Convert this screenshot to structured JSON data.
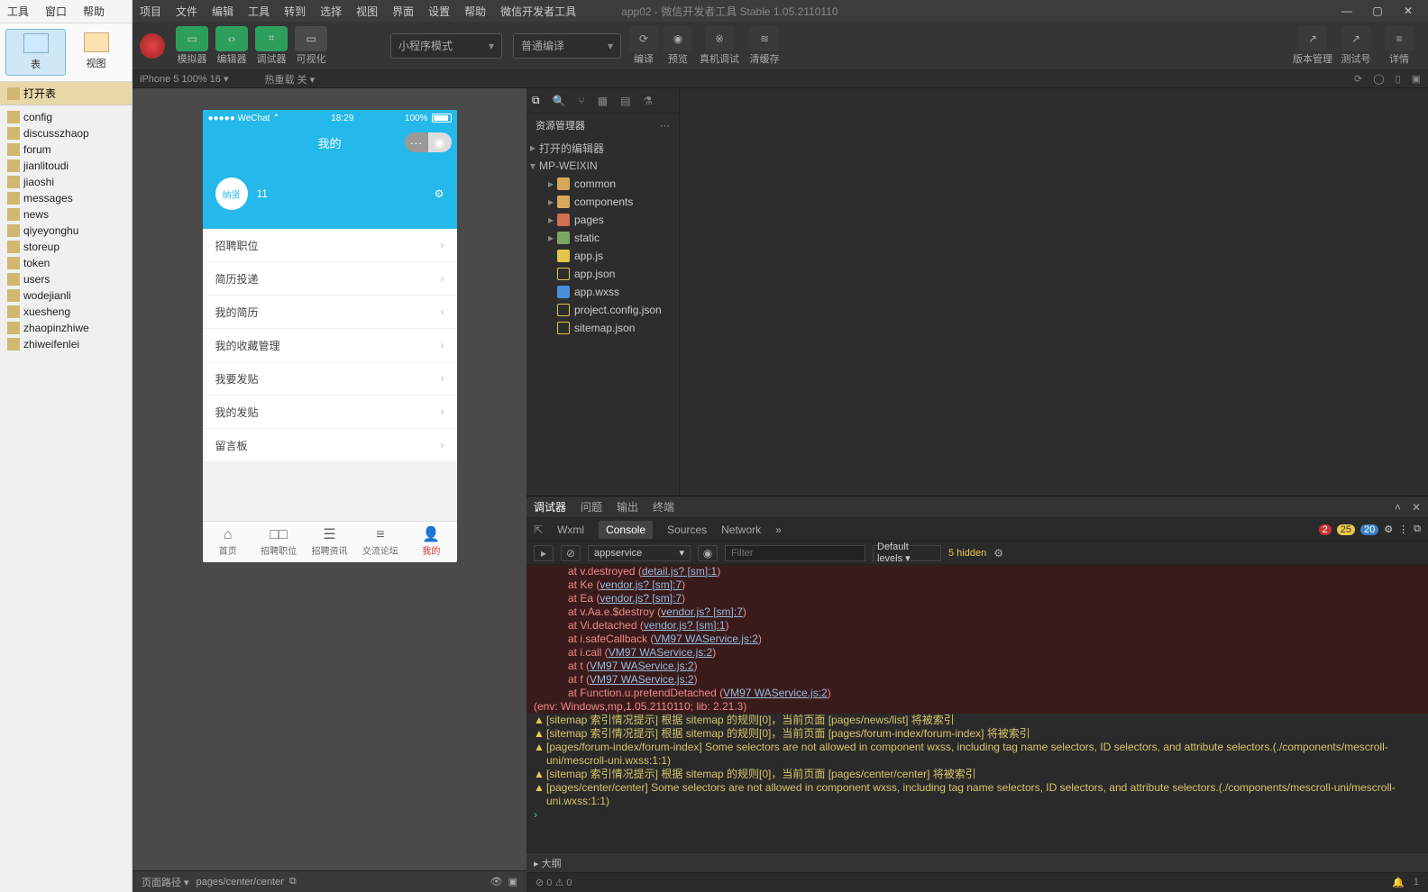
{
  "host": {
    "menu": [
      "工具",
      "窗口",
      "帮助"
    ],
    "ribbon": [
      {
        "label": "表",
        "active": true
      },
      {
        "label": "视图",
        "active": false
      }
    ],
    "open_tab": "打开表",
    "tables": [
      "config",
      "discusszhaop",
      "forum",
      "jianlitoudi",
      "jiaoshi",
      "messages",
      "news",
      "qiyeyonghu",
      "storeup",
      "token",
      "users",
      "wodejianli",
      "xuesheng",
      "zhaopinzhiwe",
      "zhiweifenlei"
    ]
  },
  "devtools": {
    "menu": [
      "项目",
      "文件",
      "编辑",
      "工具",
      "转到",
      "选择",
      "视图",
      "界面",
      "设置",
      "帮助",
      "微信开发者工具"
    ],
    "title": "app02 - 微信开发者工具 Stable 1.05.2110110",
    "modes": [
      "模拟器",
      "编辑器",
      "调试器",
      "可视化"
    ],
    "mode_dropdown": "小程序模式",
    "compile_dropdown": "普通编译",
    "compile_actions": [
      "编译",
      "预览",
      "真机调试",
      "清缓存"
    ],
    "right_actions": [
      "版本管理",
      "测试号",
      "详情"
    ],
    "substatus_left": "iPhone 5 100% 16 ▾",
    "substatus_hot": "热重载 关 ▾"
  },
  "phone": {
    "statusbar": {
      "carrier": "●●●●● WeChat ⌃",
      "time": "18:29",
      "battery": "100%"
    },
    "header_title": "我的",
    "user_name": "纳贤",
    "user_badge": "11",
    "menu": [
      "招聘职位",
      "简历投递",
      "我的简历",
      "我的收藏管理",
      "我要发贴",
      "我的发贴",
      "留言板"
    ],
    "tabbar": [
      {
        "icon": "⌂",
        "label": "首页"
      },
      {
        "icon": "□□",
        "label": "招聘职位"
      },
      {
        "icon": "☰",
        "label": "招聘资讯"
      },
      {
        "icon": "≡",
        "label": "交流论坛"
      },
      {
        "icon": "👤",
        "label": "我的"
      }
    ]
  },
  "sim_bottom": {
    "route_label": "页面路径 ▾",
    "route_path": "pages/center/center"
  },
  "explorer": {
    "panel_title": "资源管理器",
    "groups": [
      "打开的编辑器",
      "MP-WEIXIN"
    ],
    "tree": [
      {
        "type": "folder",
        "icon": "folder",
        "label": "common",
        "depth": 1
      },
      {
        "type": "folder",
        "icon": "folder",
        "label": "components",
        "depth": 1
      },
      {
        "type": "folder",
        "icon": "folder-r",
        "label": "pages",
        "depth": 1
      },
      {
        "type": "folder",
        "icon": "folder-g",
        "label": "static",
        "depth": 1
      },
      {
        "type": "file",
        "icon": "js",
        "label": "app.js",
        "depth": 1
      },
      {
        "type": "file",
        "icon": "json",
        "label": "app.json",
        "depth": 1
      },
      {
        "type": "file",
        "icon": "wxss",
        "label": "app.wxss",
        "depth": 1
      },
      {
        "type": "file",
        "icon": "json",
        "label": "project.config.json",
        "depth": 1
      },
      {
        "type": "file",
        "icon": "json",
        "label": "sitemap.json",
        "depth": 1
      }
    ]
  },
  "console": {
    "tabs": [
      "调试器",
      "问题",
      "输出",
      "终端"
    ],
    "subtabs": [
      "Wxml",
      "Console",
      "Sources",
      "Network"
    ],
    "subtabs_more": "»",
    "badges": {
      "errors": "2",
      "warns": "25",
      "info": "20"
    },
    "context": "appservice",
    "filter_placeholder": "Filter",
    "levels": "Default levels ▾",
    "hidden": "5 hidden",
    "errors": [
      {
        "at": "at v.destroyed (",
        "link": "detail.js? [sm]:1",
        "rest": ")"
      },
      {
        "at": "at Ke (",
        "link": "vendor.js? [sm]:7",
        "rest": ")"
      },
      {
        "at": "at Ea (",
        "link": "vendor.js? [sm]:7",
        "rest": ")"
      },
      {
        "at": "at v.Aa.e.$destroy (",
        "link": "vendor.js? [sm]:7",
        "rest": ")"
      },
      {
        "at": "at Vi.detached (",
        "link": "vendor.js? [sm]:1",
        "rest": ")"
      },
      {
        "at": "at i.safeCallback (",
        "link": "VM97 WAService.js:2",
        "rest": ")"
      },
      {
        "at": "at i.call (",
        "link": "VM97 WAService.js:2",
        "rest": ")"
      },
      {
        "at": "at t (",
        "link": "VM97 WAService.js:2",
        "rest": ")"
      },
      {
        "at": "at f (",
        "link": "VM97 WAService.js:2",
        "rest": ")"
      },
      {
        "at": "at Function.u.pretendDetached (",
        "link": "VM97 WAService.js:2",
        "rest": ")"
      }
    ],
    "env_line": "(env: Windows,mp,1.05.2110110; lib: 2.21.3)",
    "warnings": [
      "[sitemap 索引情况提示] 根据 sitemap 的规则[0]，当前页面 [pages/news/list] 将被索引",
      "[sitemap 索引情况提示] 根据 sitemap 的规则[0]，当前页面 [pages/forum-index/forum-index] 将被索引",
      "[pages/forum-index/forum-index] Some selectors are not allowed in component wxss, including tag name selectors, ID selectors, and attribute selectors.(./components/mescroll-uni/mescroll-uni.wxss:1:1)",
      "[sitemap 索引情况提示] 根据 sitemap 的规则[0]，当前页面 [pages/center/center] 将被索引",
      "[pages/center/center] Some selectors are not allowed in component wxss, including tag name selectors, ID selectors, and attribute selectors.(./components/mescroll-uni/mescroll-uni.wxss:1:1)"
    ],
    "prompt": "›"
  },
  "outline": "▸ 大纲",
  "bottom_status": {
    "left": "⊘ 0 ⚠ 0",
    "bell": "🔔",
    "one": "1"
  }
}
